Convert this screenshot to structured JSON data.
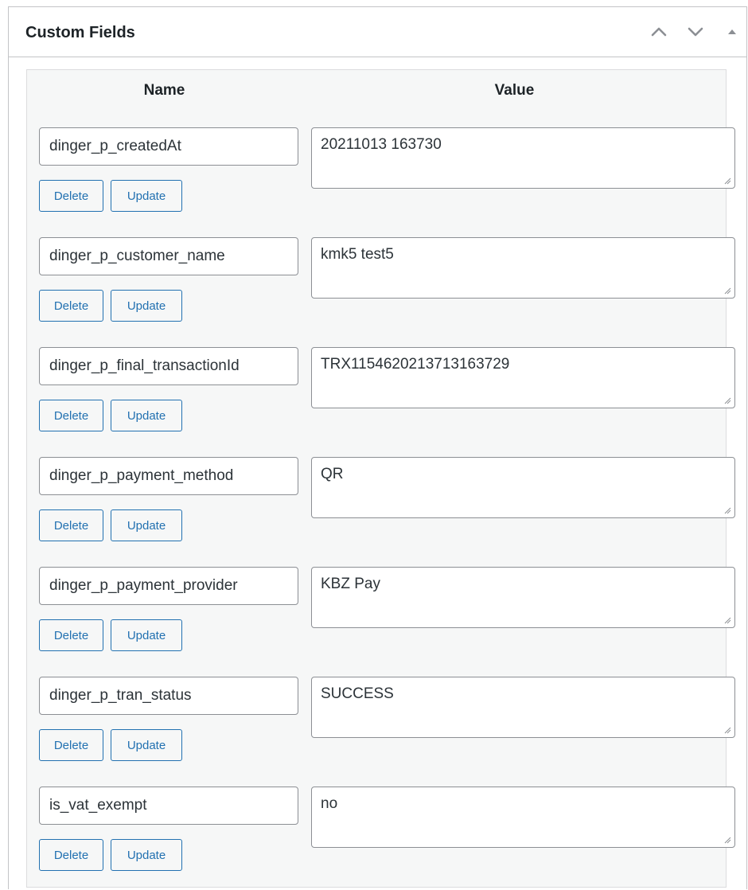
{
  "panel": {
    "title": "Custom Fields",
    "icons": [
      "chevron-up-icon",
      "chevron-down-icon",
      "triangle-up-icon"
    ]
  },
  "table": {
    "col_name": "Name",
    "col_value": "Value"
  },
  "buttons": {
    "delete_label": "Delete",
    "update_label": "Update"
  },
  "fields": [
    {
      "key": "dinger_p_createdAt",
      "value": "20211013 163730"
    },
    {
      "key": "dinger_p_customer_name",
      "value": "kmk5 test5"
    },
    {
      "key": "dinger_p_final_transactionId",
      "value": "TRX1154620213713163729"
    },
    {
      "key": "dinger_p_payment_method",
      "value": "QR"
    },
    {
      "key": "dinger_p_payment_provider",
      "value": "KBZ Pay"
    },
    {
      "key": "dinger_p_tran_status",
      "value": "SUCCESS"
    },
    {
      "key": "is_vat_exempt",
      "value": "no"
    }
  ],
  "colors": {
    "accent": "#2271b1",
    "border": "#8c8f94",
    "table_bg": "#f6f7f7"
  }
}
